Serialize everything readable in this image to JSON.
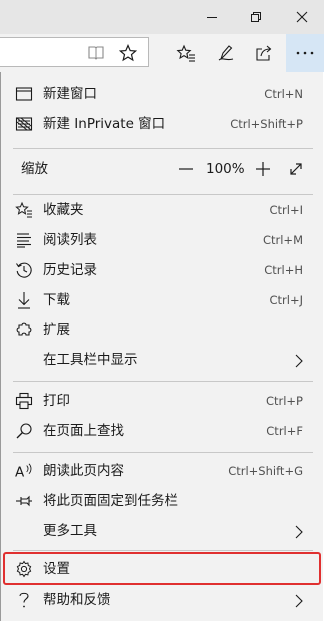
{
  "window": {
    "minimize_icon": "minimize-icon",
    "restore_icon": "restore-icon",
    "close_icon": "close-icon"
  },
  "toolbar": {
    "reading_view_icon": "book-icon",
    "favorite_icon": "star-icon",
    "favorites_hub_icon": "star-list-icon",
    "notes_icon": "pen-icon",
    "share_icon": "share-icon",
    "more_icon": "ellipsis-icon"
  },
  "menu": {
    "new_window": {
      "label": "新建窗口",
      "shortcut": "Ctrl+N",
      "icon": "window-icon"
    },
    "new_inprivate": {
      "label": "新建 InPrivate 窗口",
      "shortcut": "Ctrl+Shift+P",
      "icon": "inprivate-icon"
    },
    "zoom": {
      "label": "缩放",
      "value": "100%",
      "minus_icon": "minus-icon",
      "plus_icon": "plus-icon",
      "fullscreen_icon": "fullscreen-icon"
    },
    "favorites": {
      "label": "收藏夹",
      "shortcut": "Ctrl+I",
      "icon": "star-list-icon"
    },
    "reading_list": {
      "label": "阅读列表",
      "shortcut": "Ctrl+M",
      "icon": "reading-list-icon"
    },
    "history": {
      "label": "历史记录",
      "shortcut": "Ctrl+H",
      "icon": "history-icon"
    },
    "downloads": {
      "label": "下载",
      "shortcut": "Ctrl+J",
      "icon": "download-icon"
    },
    "extensions": {
      "label": "扩展",
      "icon": "puzzle-icon"
    },
    "show_in_toolbar": {
      "label": "在工具栏中显示",
      "icon": "chevron-right-icon"
    },
    "print": {
      "label": "打印",
      "shortcut": "Ctrl+P",
      "icon": "printer-icon"
    },
    "find": {
      "label": "在页面上查找",
      "shortcut": "Ctrl+F",
      "icon": "search-icon"
    },
    "read_aloud": {
      "label": "朗读此页内容",
      "shortcut": "Ctrl+Shift+G",
      "icon": "read-aloud-icon"
    },
    "pin_taskbar": {
      "label": "将此页面固定到任务栏",
      "icon": "pin-icon"
    },
    "more_tools": {
      "label": "更多工具",
      "icon": "chevron-right-icon"
    },
    "settings": {
      "label": "设置",
      "icon": "gear-icon"
    },
    "help": {
      "label": "帮助和反馈",
      "icon": "question-icon"
    }
  },
  "colors": {
    "highlight_border": "#e03030",
    "active_button_bg": "#d6e6f5",
    "menu_bg": "#f2f2f2"
  }
}
